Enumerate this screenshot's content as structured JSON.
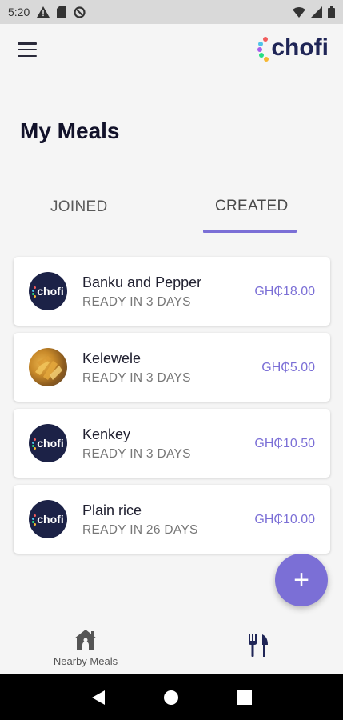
{
  "status_bar": {
    "time": "5:20",
    "icons": [
      "warning-icon",
      "sd-card-icon",
      "data-saver-icon",
      "wifi-icon",
      "signal-icon",
      "battery-icon"
    ]
  },
  "app_bar": {
    "menu_icon": "hamburger-menu-icon",
    "brand": "chofi",
    "brand_colors": [
      "#f25c5c",
      "#4fc3e8",
      "#f7b731",
      "#a55eea",
      "#26de81",
      "#fd9644"
    ]
  },
  "page": {
    "title": "My Meals"
  },
  "tabs": [
    {
      "label": "JOINED",
      "selected": false
    },
    {
      "label": "CREATED",
      "selected": true
    }
  ],
  "meals": [
    {
      "name": "Banku and Pepper",
      "status": "READY IN 3 DAYS",
      "price": "GH₵18.00",
      "image": "chofi-logo"
    },
    {
      "name": "Kelewele",
      "status": "READY IN 3 DAYS",
      "price": "GH₵5.00",
      "image": "food-photo"
    },
    {
      "name": "Kenkey",
      "status": "READY IN 3 DAYS",
      "price": "GH₵10.50",
      "image": "chofi-logo"
    },
    {
      "name": "Plain rice",
      "status": "READY IN 26 DAYS",
      "price": "GH₵10.00",
      "image": "chofi-logo"
    }
  ],
  "fab": {
    "label": "+",
    "icon": "add-icon"
  },
  "bottom_nav": [
    {
      "label": "Nearby Meals",
      "icon": "house-icon"
    },
    {
      "label": "",
      "icon": "fork-knife-icon"
    }
  ],
  "system_nav": [
    "back-icon",
    "home-icon",
    "recents-icon"
  ],
  "colors": {
    "accent": "#7b6fd6",
    "brand_navy": "#1f2556",
    "background": "#f5f5f5",
    "status_bar": "#d9d9d9"
  }
}
